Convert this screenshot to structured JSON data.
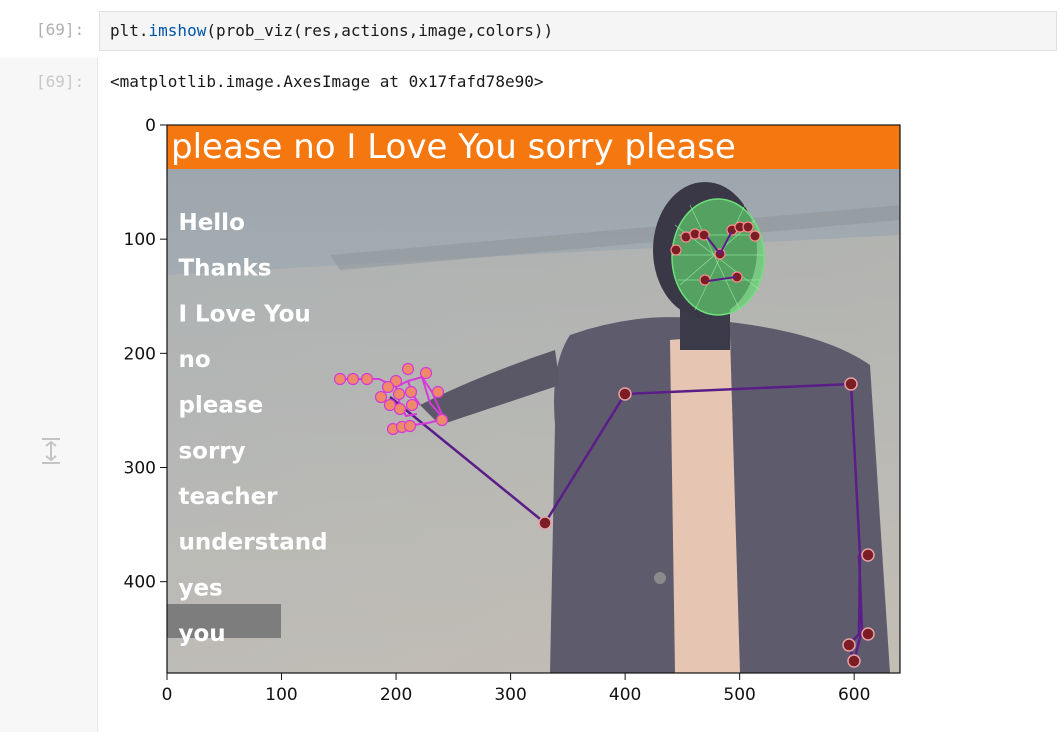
{
  "input_cell": {
    "prompt": "[69]:",
    "code_fn": "plt.",
    "code_call": "imshow",
    "code_args": "(prob_viz(res,actions,image,colors))"
  },
  "output_cell": {
    "prompt": "[69]:",
    "text": "<matplotlib.image.AxesImage at 0x17fafd78e90>"
  },
  "image_plot": {
    "banner_text": "please no I Love You sorry please",
    "action_labels": [
      "Hello",
      "Thanks",
      "I Love You",
      "no",
      "please",
      "sorry",
      "teacher",
      "understand",
      "yes",
      "you"
    ],
    "highlighted_action": "you",
    "x_ticks": [
      "0",
      "100",
      "200",
      "300",
      "400",
      "500",
      "600"
    ],
    "y_ticks": [
      "0",
      "100",
      "200",
      "300",
      "400"
    ],
    "xlim": [
      0,
      640
    ],
    "ylim": [
      480,
      0
    ],
    "colors": {
      "banner": "#f57710",
      "highlight_bar": "#7d7d7d",
      "pose_line": "#5b1e88",
      "hand_line": "#d53ad8",
      "face_mesh": "#6ee07a"
    }
  }
}
